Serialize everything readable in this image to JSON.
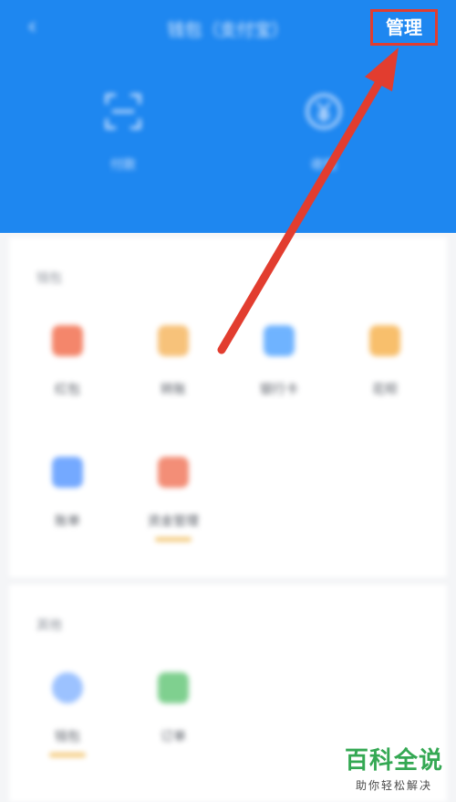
{
  "header": {
    "title": "钱包（支付宝）",
    "manage_label": "管理",
    "quick_actions": [
      {
        "label": "付款",
        "icon": "scan-icon"
      },
      {
        "label": "收钱",
        "icon": "yen-icon"
      }
    ]
  },
  "sections": [
    {
      "title": "钱包",
      "apps": [
        {
          "label": "红包",
          "icon_color": "#f4866b"
        },
        {
          "label": "转账",
          "icon_color": "#f7c27a"
        },
        {
          "label": "银行卡",
          "icon_color": "#6fb3ff"
        },
        {
          "label": "花呗",
          "icon_color": "#f8bf6c"
        },
        {
          "label": "账单",
          "icon_color": "#74a9ff"
        },
        {
          "label": "资金管理",
          "icon_color": "#f38e77"
        }
      ]
    },
    {
      "title": "其他",
      "apps": [
        {
          "label": "钱包",
          "icon_color": "#9cc2ff"
        },
        {
          "label": "订单",
          "icon_color": "#7fd08f"
        }
      ]
    }
  ],
  "watermark": {
    "main": "百科全说",
    "sub": "助你轻松解决"
  },
  "colors": {
    "header_blue": "#1e87f0",
    "highlight_red": "#e23d2f",
    "watermark_green": "#34a853"
  }
}
